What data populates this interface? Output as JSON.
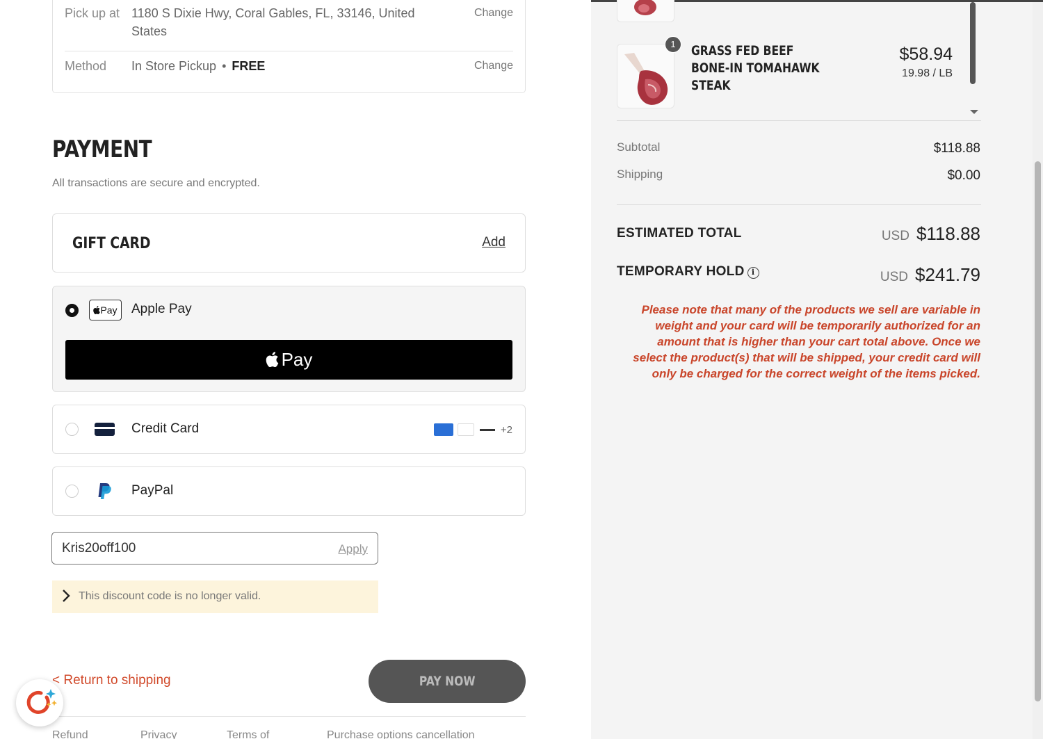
{
  "shipping": {
    "pickup_label": "Pick up at",
    "pickup_address": "1180 S Dixie Hwy, Coral Gables, FL, 33146, United States",
    "pickup_change": "Change",
    "method_label": "Method",
    "method_value": "In Store Pickup",
    "method_dot": "•",
    "method_price": "FREE",
    "method_change": "Change"
  },
  "payment": {
    "title": "PAYMENT",
    "subtitle": "All transactions are secure and encrypted.",
    "gift_card": {
      "title": "GIFT CARD",
      "add_label": "Add"
    },
    "options": [
      {
        "label": "Apple Pay",
        "badge": "Pay",
        "selected": true
      },
      {
        "label": "Credit Card",
        "selected": false,
        "more_brands": "+2"
      },
      {
        "label": "PayPal",
        "selected": false
      }
    ],
    "apple_pay_button": "Pay"
  },
  "discount": {
    "value": "Kris20off100",
    "apply_label": "Apply",
    "warning": "This discount code is no longer valid."
  },
  "actions": {
    "return_label": "< Return to shipping",
    "pay_now_label": "PAY NOW"
  },
  "footer": {
    "links": [
      "Refund",
      "Privacy",
      "Terms of",
      "Purchase options cancellation"
    ]
  },
  "summary": {
    "item": {
      "quantity": "1",
      "name": "GRASS FED BEEF BONE-IN TOMAHAWK STEAK",
      "price": "$58.94",
      "unit_price": "19.98 / LB"
    },
    "subtotal_label": "Subtotal",
    "subtotal_value": "$118.88",
    "shipping_label": "Shipping",
    "shipping_value": "$0.00",
    "estimated_total_label": "ESTIMATED TOTAL",
    "estimated_total_currency": "USD",
    "estimated_total_value": "$118.88",
    "temporary_hold_label": "TEMPORARY HOLD",
    "temporary_hold_currency": "USD",
    "temporary_hold_value": "$241.79",
    "note": "Please note that many of the products we sell are variable in weight and your card will be temporarily authorized for an amount that is higher than your cart total above. Once we select the product(s) that will be shipped, your credit card will only be charged for the correct weight of the items picked."
  },
  "colors": {
    "accent_red": "#c9452a",
    "link_red": "#d14a2b",
    "warning_bg": "#fdf4dc",
    "sidebar_bg": "#f4f4f4"
  },
  "icons": [
    "apple-pay-badge",
    "credit-card-icon",
    "paypal-icon",
    "chevron-right-icon",
    "info-icon",
    "assistant-icon",
    "scroll-down-arrow"
  ]
}
